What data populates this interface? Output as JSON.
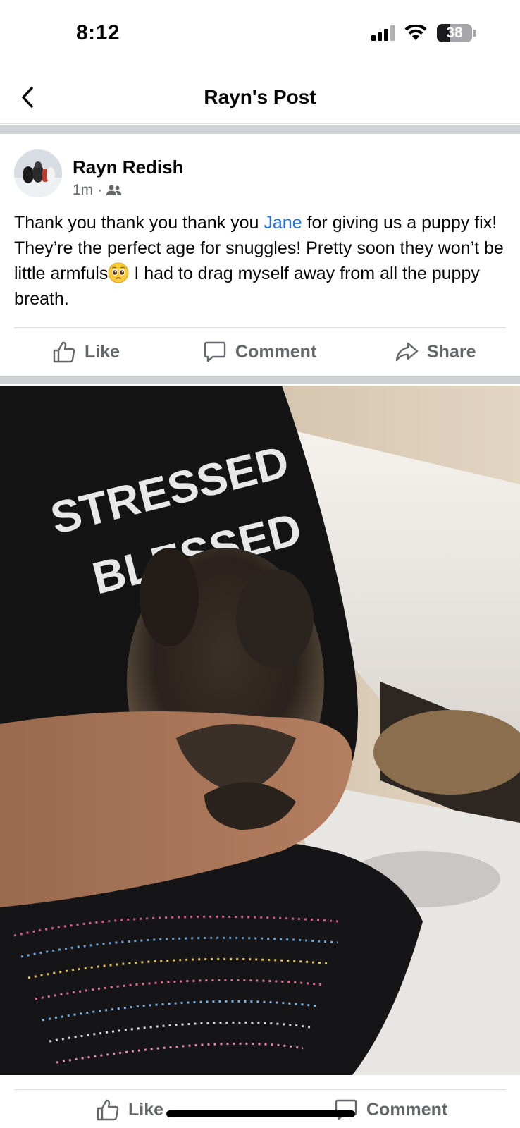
{
  "status_bar": {
    "time": "8:12",
    "battery": "38"
  },
  "nav": {
    "title": "Rayn's Post"
  },
  "post": {
    "author": "Rayn Redish",
    "timestamp": "1m",
    "separator": "·",
    "audience_icon": "friends-icon",
    "text_before_mention": "Thank you thank you thank you ",
    "mention": "Jane",
    "text_after_mention": " for giving us a puppy fix! They’re the perfect age for snuggles! Pretty soon they won’t be little armfuls",
    "emoji": "pleading-face-emoji",
    "text_after_emoji": " I had to drag myself away from all the puppy breath."
  },
  "actions": {
    "like": "Like",
    "comment": "Comment",
    "share": "Share"
  },
  "photo_actions": {
    "like": "Like",
    "comment": "Comment"
  },
  "photo": {
    "shirt_text_line1": "STRESSED",
    "shirt_text_line2": "BLESSED",
    "alt": "puppy-photo"
  },
  "colors": {
    "accent": "#216fdb",
    "muted": "#65676b",
    "divider": "#ced0d4"
  }
}
